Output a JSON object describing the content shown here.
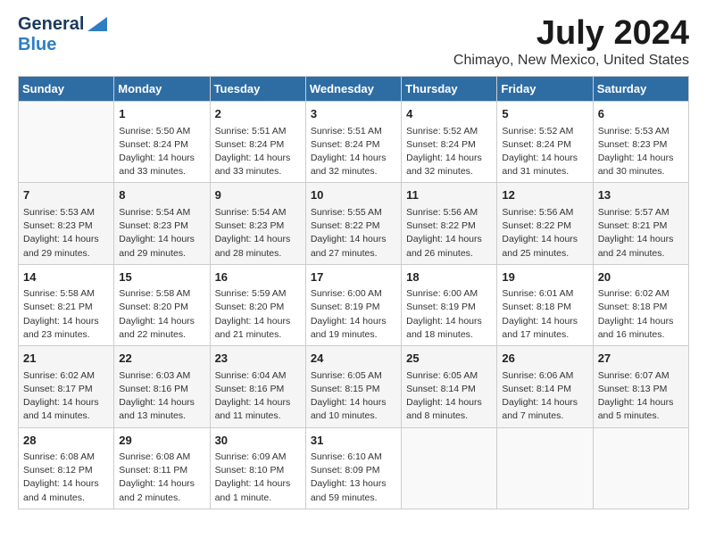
{
  "header": {
    "logo_general": "General",
    "logo_blue": "Blue",
    "title": "July 2024",
    "subtitle": "Chimayo, New Mexico, United States"
  },
  "weekdays": [
    "Sunday",
    "Monday",
    "Tuesday",
    "Wednesday",
    "Thursday",
    "Friday",
    "Saturday"
  ],
  "weeks": [
    [
      {
        "day": "",
        "info": ""
      },
      {
        "day": "1",
        "info": "Sunrise: 5:50 AM\nSunset: 8:24 PM\nDaylight: 14 hours\nand 33 minutes."
      },
      {
        "day": "2",
        "info": "Sunrise: 5:51 AM\nSunset: 8:24 PM\nDaylight: 14 hours\nand 33 minutes."
      },
      {
        "day": "3",
        "info": "Sunrise: 5:51 AM\nSunset: 8:24 PM\nDaylight: 14 hours\nand 32 minutes."
      },
      {
        "day": "4",
        "info": "Sunrise: 5:52 AM\nSunset: 8:24 PM\nDaylight: 14 hours\nand 32 minutes."
      },
      {
        "day": "5",
        "info": "Sunrise: 5:52 AM\nSunset: 8:24 PM\nDaylight: 14 hours\nand 31 minutes."
      },
      {
        "day": "6",
        "info": "Sunrise: 5:53 AM\nSunset: 8:23 PM\nDaylight: 14 hours\nand 30 minutes."
      }
    ],
    [
      {
        "day": "7",
        "info": "Sunrise: 5:53 AM\nSunset: 8:23 PM\nDaylight: 14 hours\nand 29 minutes."
      },
      {
        "day": "8",
        "info": "Sunrise: 5:54 AM\nSunset: 8:23 PM\nDaylight: 14 hours\nand 29 minutes."
      },
      {
        "day": "9",
        "info": "Sunrise: 5:54 AM\nSunset: 8:23 PM\nDaylight: 14 hours\nand 28 minutes."
      },
      {
        "day": "10",
        "info": "Sunrise: 5:55 AM\nSunset: 8:22 PM\nDaylight: 14 hours\nand 27 minutes."
      },
      {
        "day": "11",
        "info": "Sunrise: 5:56 AM\nSunset: 8:22 PM\nDaylight: 14 hours\nand 26 minutes."
      },
      {
        "day": "12",
        "info": "Sunrise: 5:56 AM\nSunset: 8:22 PM\nDaylight: 14 hours\nand 25 minutes."
      },
      {
        "day": "13",
        "info": "Sunrise: 5:57 AM\nSunset: 8:21 PM\nDaylight: 14 hours\nand 24 minutes."
      }
    ],
    [
      {
        "day": "14",
        "info": "Sunrise: 5:58 AM\nSunset: 8:21 PM\nDaylight: 14 hours\nand 23 minutes."
      },
      {
        "day": "15",
        "info": "Sunrise: 5:58 AM\nSunset: 8:20 PM\nDaylight: 14 hours\nand 22 minutes."
      },
      {
        "day": "16",
        "info": "Sunrise: 5:59 AM\nSunset: 8:20 PM\nDaylight: 14 hours\nand 21 minutes."
      },
      {
        "day": "17",
        "info": "Sunrise: 6:00 AM\nSunset: 8:19 PM\nDaylight: 14 hours\nand 19 minutes."
      },
      {
        "day": "18",
        "info": "Sunrise: 6:00 AM\nSunset: 8:19 PM\nDaylight: 14 hours\nand 18 minutes."
      },
      {
        "day": "19",
        "info": "Sunrise: 6:01 AM\nSunset: 8:18 PM\nDaylight: 14 hours\nand 17 minutes."
      },
      {
        "day": "20",
        "info": "Sunrise: 6:02 AM\nSunset: 8:18 PM\nDaylight: 14 hours\nand 16 minutes."
      }
    ],
    [
      {
        "day": "21",
        "info": "Sunrise: 6:02 AM\nSunset: 8:17 PM\nDaylight: 14 hours\nand 14 minutes."
      },
      {
        "day": "22",
        "info": "Sunrise: 6:03 AM\nSunset: 8:16 PM\nDaylight: 14 hours\nand 13 minutes."
      },
      {
        "day": "23",
        "info": "Sunrise: 6:04 AM\nSunset: 8:16 PM\nDaylight: 14 hours\nand 11 minutes."
      },
      {
        "day": "24",
        "info": "Sunrise: 6:05 AM\nSunset: 8:15 PM\nDaylight: 14 hours\nand 10 minutes."
      },
      {
        "day": "25",
        "info": "Sunrise: 6:05 AM\nSunset: 8:14 PM\nDaylight: 14 hours\nand 8 minutes."
      },
      {
        "day": "26",
        "info": "Sunrise: 6:06 AM\nSunset: 8:14 PM\nDaylight: 14 hours\nand 7 minutes."
      },
      {
        "day": "27",
        "info": "Sunrise: 6:07 AM\nSunset: 8:13 PM\nDaylight: 14 hours\nand 5 minutes."
      }
    ],
    [
      {
        "day": "28",
        "info": "Sunrise: 6:08 AM\nSunset: 8:12 PM\nDaylight: 14 hours\nand 4 minutes."
      },
      {
        "day": "29",
        "info": "Sunrise: 6:08 AM\nSunset: 8:11 PM\nDaylight: 14 hours\nand 2 minutes."
      },
      {
        "day": "30",
        "info": "Sunrise: 6:09 AM\nSunset: 8:10 PM\nDaylight: 14 hours\nand 1 minute."
      },
      {
        "day": "31",
        "info": "Sunrise: 6:10 AM\nSunset: 8:09 PM\nDaylight: 13 hours\nand 59 minutes."
      },
      {
        "day": "",
        "info": ""
      },
      {
        "day": "",
        "info": ""
      },
      {
        "day": "",
        "info": ""
      }
    ]
  ]
}
